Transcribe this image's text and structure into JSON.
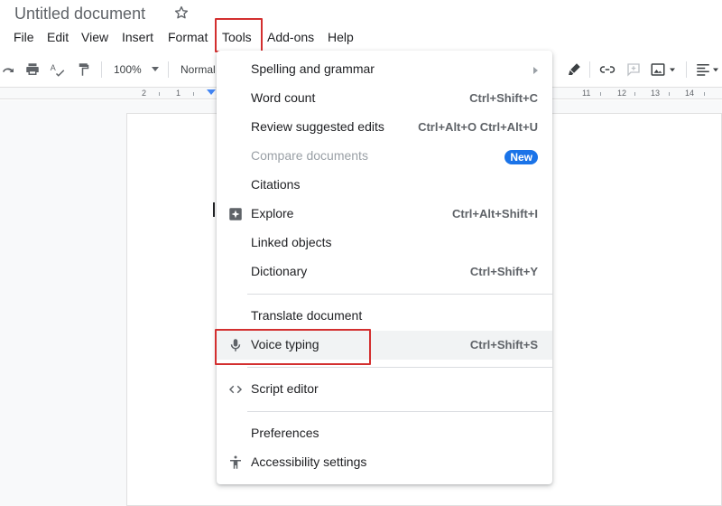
{
  "app": {
    "doc_title": "Untitled document"
  },
  "menubar": {
    "items": [
      "File",
      "Edit",
      "View",
      "Insert",
      "Format",
      "Tools",
      "Add-ons",
      "Help"
    ],
    "active": "Tools"
  },
  "toolbar": {
    "zoom": "100%",
    "style": "Normal",
    "icons": [
      "redo-icon",
      "print-icon",
      "spellcheck-icon",
      "paint-format-icon",
      "highlight-icon",
      "link-icon",
      "comment-icon",
      "image-icon",
      "align-icon"
    ]
  },
  "ruler": {
    "left_labels": [
      "2",
      "1"
    ],
    "right_labels": [
      "11",
      "12",
      "13",
      "14"
    ]
  },
  "tools_menu": {
    "items": [
      {
        "label": "Spelling and grammar",
        "shortcut": "",
        "submenu": true
      },
      {
        "label": "Word count",
        "shortcut": "Ctrl+Shift+C"
      },
      {
        "label": "Review suggested edits",
        "shortcut": "Ctrl+Alt+O Ctrl+Alt+U"
      },
      {
        "label": "Compare documents",
        "badge": "New",
        "disabled": true
      },
      {
        "label": "Citations",
        "shortcut": ""
      },
      {
        "label": "Explore",
        "shortcut": "Ctrl+Alt+Shift+I",
        "icon": "explore-icon"
      },
      {
        "label": "Linked objects",
        "shortcut": ""
      },
      {
        "label": "Dictionary",
        "shortcut": "Ctrl+Shift+Y"
      },
      {
        "label": "Translate document",
        "shortcut": ""
      },
      {
        "label": "Voice typing",
        "shortcut": "Ctrl+Shift+S",
        "icon": "microphone-icon",
        "highlighted": true
      },
      {
        "label": "Script editor",
        "shortcut": "",
        "icon": "code-icon"
      },
      {
        "label": "Preferences",
        "shortcut": ""
      },
      {
        "label": "Accessibility settings",
        "shortcut": "",
        "icon": "accessibility-icon"
      }
    ]
  },
  "colors": {
    "highlight_box": "#d32f2f",
    "badge": "#1a73e8",
    "row_hover": "#f1f3f4"
  }
}
